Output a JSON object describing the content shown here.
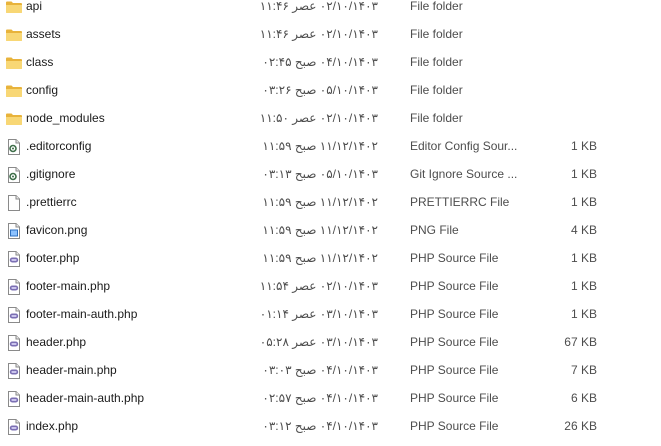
{
  "files": [
    {
      "name": "api",
      "date": "۰۲/۱۰/۱۴۰۳ عصر ۱۱:۴۶",
      "type": "File folder",
      "size": "",
      "icon": "folder-icon"
    },
    {
      "name": "assets",
      "date": "۰۲/۱۰/۱۴۰۳ عصر ۱۱:۴۶",
      "type": "File folder",
      "size": "",
      "icon": "folder-icon"
    },
    {
      "name": "class",
      "date": "۰۴/۱۰/۱۴۰۳ صبح ۰۲:۴۵",
      "type": "File folder",
      "size": "",
      "icon": "folder-icon"
    },
    {
      "name": "config",
      "date": "۰۵/۱۰/۱۴۰۳ صبح ۰۳:۲۶",
      "type": "File folder",
      "size": "",
      "icon": "folder-icon"
    },
    {
      "name": "node_modules",
      "date": "۰۲/۱۰/۱۴۰۳ عصر ۱۱:۵۰",
      "type": "File folder",
      "size": "",
      "icon": "folder-icon"
    },
    {
      "name": ".editorconfig",
      "date": "۱۱/۱۲/۱۴۰۲ صبح ۱۱:۵۹",
      "type": "Editor Config Sour...",
      "size": "1 KB",
      "icon": "config-file-icon"
    },
    {
      "name": ".gitignore",
      "date": "۰۵/۱۰/۱۴۰۳ صبح ۰۳:۱۳",
      "type": "Git Ignore Source ...",
      "size": "1 KB",
      "icon": "config-file-icon"
    },
    {
      "name": ".prettierrc",
      "date": "۱۱/۱۲/۱۴۰۲ صبح ۱۱:۵۹",
      "type": "PRETTIERRC File",
      "size": "1 KB",
      "icon": "blank-file-icon"
    },
    {
      "name": "favicon.png",
      "date": "۱۱/۱۲/۱۴۰۲ صبح ۱۱:۵۹",
      "type": "PNG File",
      "size": "4 KB",
      "icon": "image-file-icon"
    },
    {
      "name": "footer.php",
      "date": "۱۱/۱۲/۱۴۰۲ صبح ۱۱:۵۹",
      "type": "PHP Source File",
      "size": "1 KB",
      "icon": "php-file-icon"
    },
    {
      "name": "footer-main.php",
      "date": "۰۲/۱۰/۱۴۰۳ عصر ۱۱:۵۴",
      "type": "PHP Source File",
      "size": "1 KB",
      "icon": "php-file-icon"
    },
    {
      "name": "footer-main-auth.php",
      "date": "۰۳/۱۰/۱۴۰۳ عصر ۰۱:۱۴",
      "type": "PHP Source File",
      "size": "1 KB",
      "icon": "php-file-icon"
    },
    {
      "name": "header.php",
      "date": "۰۳/۱۰/۱۴۰۳ عصر ۰۵:۲۸",
      "type": "PHP Source File",
      "size": "67 KB",
      "icon": "php-file-icon"
    },
    {
      "name": "header-main.php",
      "date": "۰۴/۱۰/۱۴۰۳ صبح ۰۳:۰۳",
      "type": "PHP Source File",
      "size": "7 KB",
      "icon": "php-file-icon"
    },
    {
      "name": "header-main-auth.php",
      "date": "۰۴/۱۰/۱۴۰۳ صبح ۰۲:۵۷",
      "type": "PHP Source File",
      "size": "6 KB",
      "icon": "php-file-icon"
    },
    {
      "name": "index.php",
      "date": "۰۴/۱۰/۱۴۰۳ صبح ۰۳:۱۲",
      "type": "PHP Source File",
      "size": "26 KB",
      "icon": "php-file-icon"
    }
  ]
}
